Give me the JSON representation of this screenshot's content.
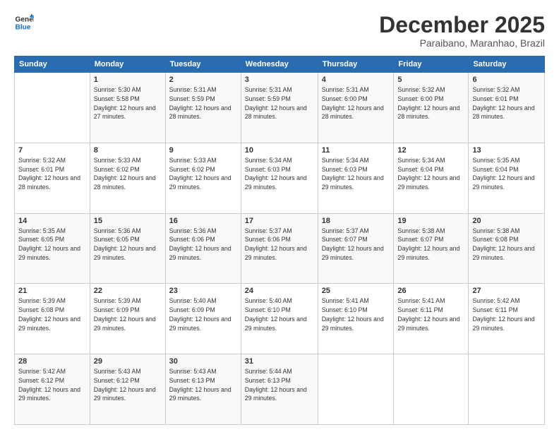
{
  "logo": {
    "line1": "General",
    "line2": "Blue"
  },
  "header": {
    "month": "December 2025",
    "location": "Paraibano, Maranhao, Brazil"
  },
  "weekdays": [
    "Sunday",
    "Monday",
    "Tuesday",
    "Wednesday",
    "Thursday",
    "Friday",
    "Saturday"
  ],
  "weeks": [
    [
      {
        "day": "",
        "info": ""
      },
      {
        "day": "1",
        "info": "Sunrise: 5:30 AM\nSunset: 5:58 PM\nDaylight: 12 hours\nand 27 minutes."
      },
      {
        "day": "2",
        "info": "Sunrise: 5:31 AM\nSunset: 5:59 PM\nDaylight: 12 hours\nand 28 minutes."
      },
      {
        "day": "3",
        "info": "Sunrise: 5:31 AM\nSunset: 5:59 PM\nDaylight: 12 hours\nand 28 minutes."
      },
      {
        "day": "4",
        "info": "Sunrise: 5:31 AM\nSunset: 6:00 PM\nDaylight: 12 hours\nand 28 minutes."
      },
      {
        "day": "5",
        "info": "Sunrise: 5:32 AM\nSunset: 6:00 PM\nDaylight: 12 hours\nand 28 minutes."
      },
      {
        "day": "6",
        "info": "Sunrise: 5:32 AM\nSunset: 6:01 PM\nDaylight: 12 hours\nand 28 minutes."
      }
    ],
    [
      {
        "day": "7",
        "info": "Sunrise: 5:32 AM\nSunset: 6:01 PM\nDaylight: 12 hours\nand 28 minutes."
      },
      {
        "day": "8",
        "info": "Sunrise: 5:33 AM\nSunset: 6:02 PM\nDaylight: 12 hours\nand 28 minutes."
      },
      {
        "day": "9",
        "info": "Sunrise: 5:33 AM\nSunset: 6:02 PM\nDaylight: 12 hours\nand 29 minutes."
      },
      {
        "day": "10",
        "info": "Sunrise: 5:34 AM\nSunset: 6:03 PM\nDaylight: 12 hours\nand 29 minutes."
      },
      {
        "day": "11",
        "info": "Sunrise: 5:34 AM\nSunset: 6:03 PM\nDaylight: 12 hours\nand 29 minutes."
      },
      {
        "day": "12",
        "info": "Sunrise: 5:34 AM\nSunset: 6:04 PM\nDaylight: 12 hours\nand 29 minutes."
      },
      {
        "day": "13",
        "info": "Sunrise: 5:35 AM\nSunset: 6:04 PM\nDaylight: 12 hours\nand 29 minutes."
      }
    ],
    [
      {
        "day": "14",
        "info": "Sunrise: 5:35 AM\nSunset: 6:05 PM\nDaylight: 12 hours\nand 29 minutes."
      },
      {
        "day": "15",
        "info": "Sunrise: 5:36 AM\nSunset: 6:05 PM\nDaylight: 12 hours\nand 29 minutes."
      },
      {
        "day": "16",
        "info": "Sunrise: 5:36 AM\nSunset: 6:06 PM\nDaylight: 12 hours\nand 29 minutes."
      },
      {
        "day": "17",
        "info": "Sunrise: 5:37 AM\nSunset: 6:06 PM\nDaylight: 12 hours\nand 29 minutes."
      },
      {
        "day": "18",
        "info": "Sunrise: 5:37 AM\nSunset: 6:07 PM\nDaylight: 12 hours\nand 29 minutes."
      },
      {
        "day": "19",
        "info": "Sunrise: 5:38 AM\nSunset: 6:07 PM\nDaylight: 12 hours\nand 29 minutes."
      },
      {
        "day": "20",
        "info": "Sunrise: 5:38 AM\nSunset: 6:08 PM\nDaylight: 12 hours\nand 29 minutes."
      }
    ],
    [
      {
        "day": "21",
        "info": "Sunrise: 5:39 AM\nSunset: 6:08 PM\nDaylight: 12 hours\nand 29 minutes."
      },
      {
        "day": "22",
        "info": "Sunrise: 5:39 AM\nSunset: 6:09 PM\nDaylight: 12 hours\nand 29 minutes."
      },
      {
        "day": "23",
        "info": "Sunrise: 5:40 AM\nSunset: 6:09 PM\nDaylight: 12 hours\nand 29 minutes."
      },
      {
        "day": "24",
        "info": "Sunrise: 5:40 AM\nSunset: 6:10 PM\nDaylight: 12 hours\nand 29 minutes."
      },
      {
        "day": "25",
        "info": "Sunrise: 5:41 AM\nSunset: 6:10 PM\nDaylight: 12 hours\nand 29 minutes."
      },
      {
        "day": "26",
        "info": "Sunrise: 5:41 AM\nSunset: 6:11 PM\nDaylight: 12 hours\nand 29 minutes."
      },
      {
        "day": "27",
        "info": "Sunrise: 5:42 AM\nSunset: 6:11 PM\nDaylight: 12 hours\nand 29 minutes."
      }
    ],
    [
      {
        "day": "28",
        "info": "Sunrise: 5:42 AM\nSunset: 6:12 PM\nDaylight: 12 hours\nand 29 minutes."
      },
      {
        "day": "29",
        "info": "Sunrise: 5:43 AM\nSunset: 6:12 PM\nDaylight: 12 hours\nand 29 minutes."
      },
      {
        "day": "30",
        "info": "Sunrise: 5:43 AM\nSunset: 6:13 PM\nDaylight: 12 hours\nand 29 minutes."
      },
      {
        "day": "31",
        "info": "Sunrise: 5:44 AM\nSunset: 6:13 PM\nDaylight: 12 hours\nand 29 minutes."
      },
      {
        "day": "",
        "info": ""
      },
      {
        "day": "",
        "info": ""
      },
      {
        "day": "",
        "info": ""
      }
    ]
  ]
}
